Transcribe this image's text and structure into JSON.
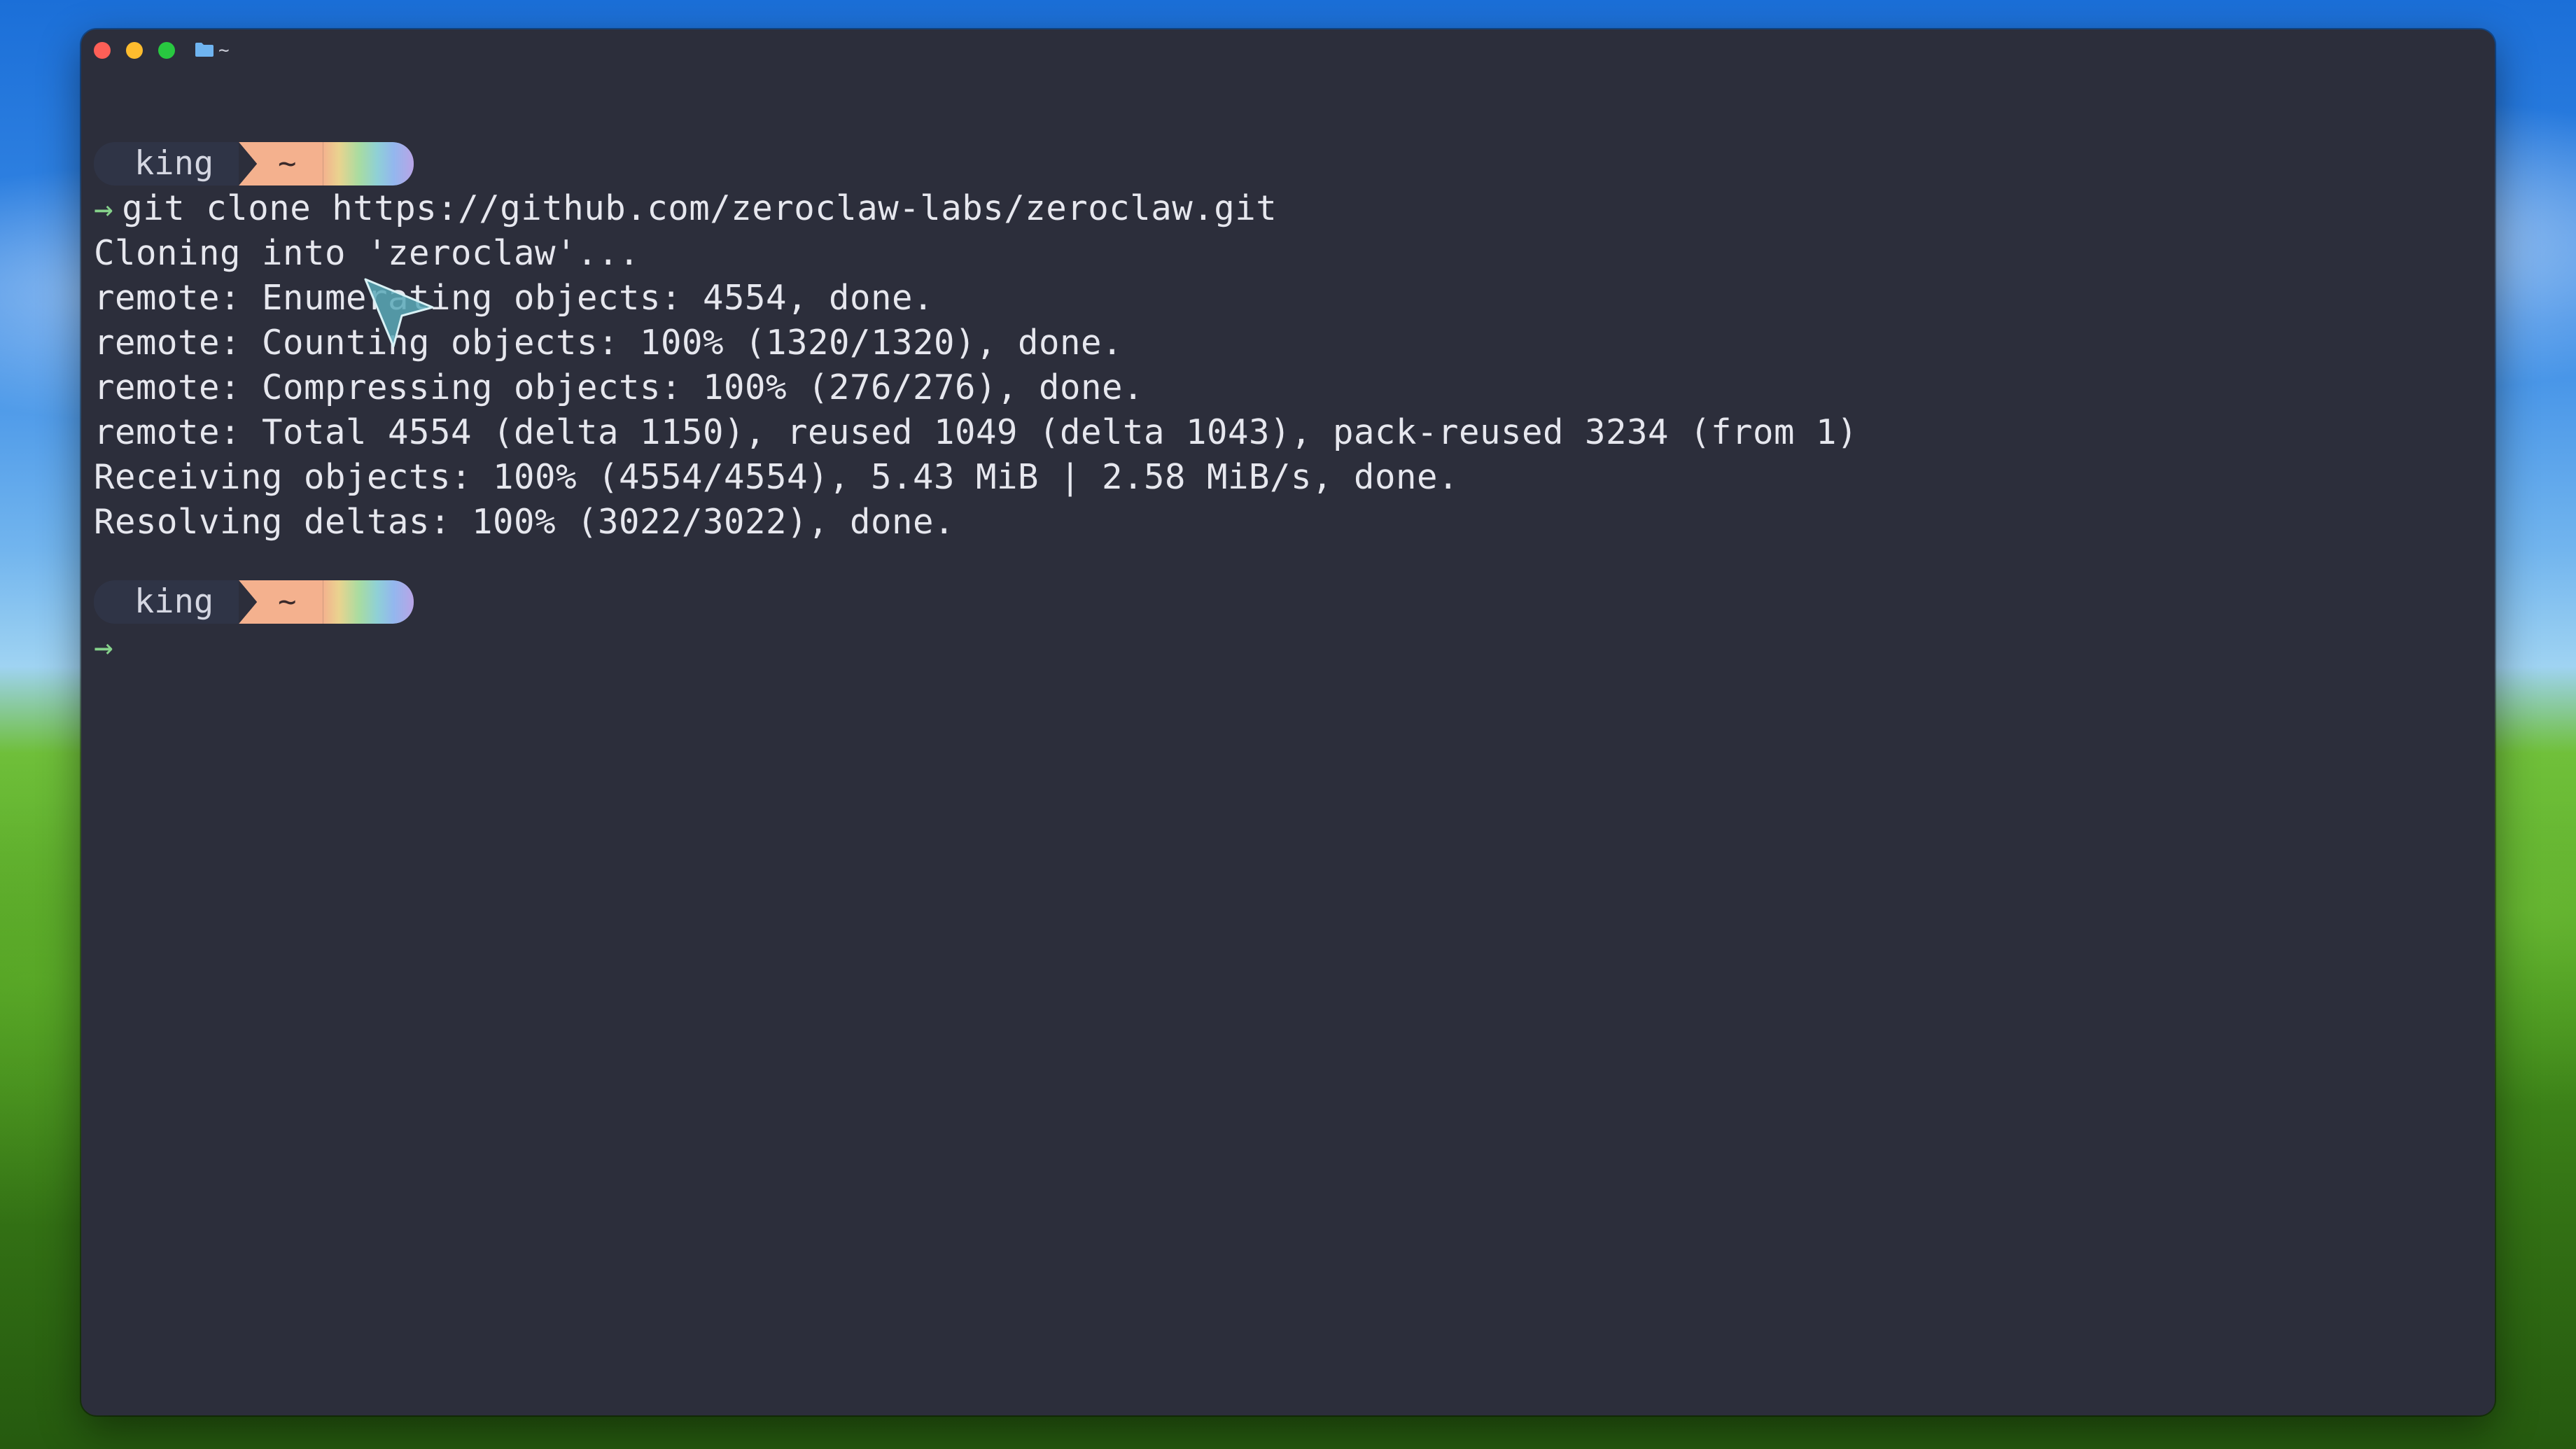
{
  "window": {
    "title": "~",
    "title_icon": "folder-icon"
  },
  "terminal": {
    "prompts": [
      {
        "user": "king",
        "path": "~"
      },
      {
        "user": "king",
        "path": "~"
      }
    ],
    "prompt_arrow": "→",
    "command": "git clone https://github.com/zeroclaw-labs/zeroclaw.git",
    "output": [
      "Cloning into 'zeroclaw'...",
      "remote: Enumerating objects: 4554, done.",
      "remote: Counting objects: 100% (1320/1320), done.",
      "remote: Compressing objects: 100% (276/276), done.",
      "remote: Total 4554 (delta 1150), reused 1049 (delta 1043), pack-reused 3234 (from 1)",
      "Receiving objects: 100% (4554/4554), 5.43 MiB | 2.58 MiB/s, done.",
      "Resolving deltas: 100% (3022/3022), done."
    ]
  },
  "colors": {
    "terminal_bg": "#2c2e3b",
    "text": "#e6e7ee",
    "prompt_arrow": "#86d28b",
    "prompt_user_bg": "#2f3446",
    "prompt_path_bg": "#f4b18e"
  }
}
